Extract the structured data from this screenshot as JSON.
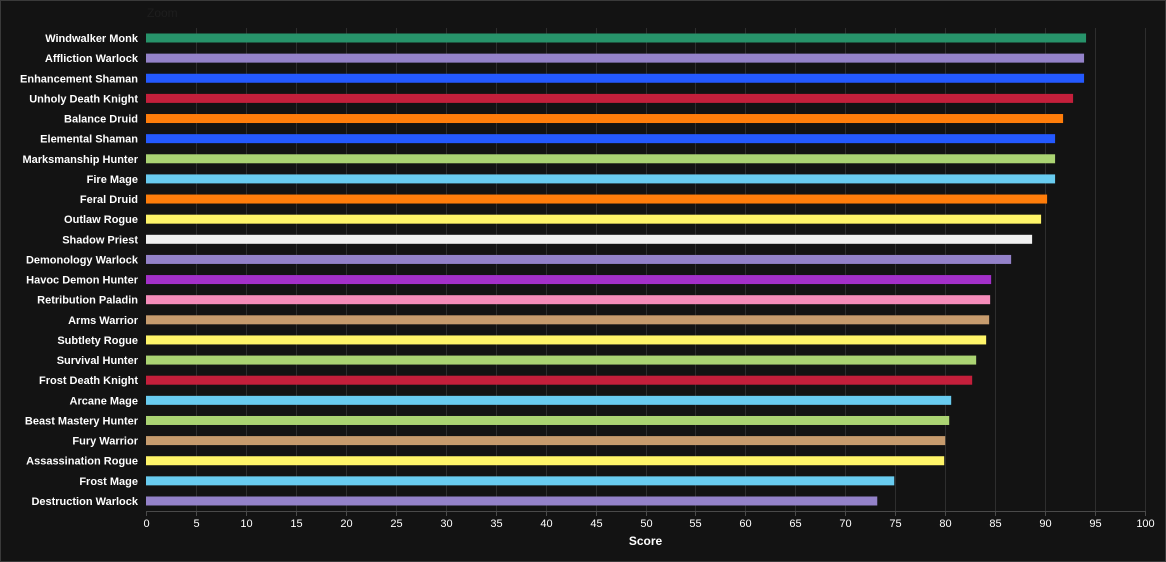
{
  "toolbar": {
    "zoom_label": "Zoom"
  },
  "chart_data": {
    "type": "bar",
    "orientation": "horizontal",
    "categories": [
      "Windwalker Monk",
      "Affliction Warlock",
      "Enhancement Shaman",
      "Unholy Death Knight",
      "Balance Druid",
      "Elemental Shaman",
      "Marksmanship Hunter",
      "Fire Mage",
      "Feral Druid",
      "Outlaw Rogue",
      "Shadow Priest",
      "Demonology Warlock",
      "Havoc Demon Hunter",
      "Retribution Paladin",
      "Arms Warrior",
      "Subtlety Rogue",
      "Survival Hunter",
      "Frost Death Knight",
      "Arcane Mage",
      "Beast Mastery Hunter",
      "Fury Warrior",
      "Assassination Rogue",
      "Frost Mage",
      "Destruction Warlock"
    ],
    "values": [
      94.1,
      93.9,
      93.9,
      92.8,
      91.8,
      91.0,
      91.0,
      91.0,
      90.2,
      89.6,
      88.7,
      86.6,
      84.6,
      84.5,
      84.4,
      84.1,
      83.1,
      82.7,
      80.6,
      80.4,
      80.0,
      79.9,
      74.9,
      73.2
    ],
    "colors": [
      "#27936a",
      "#9482c9",
      "#2459ff",
      "#c41f3b",
      "#ff7d0a",
      "#2459ff",
      "#abd473",
      "#69ccf0",
      "#ff7d0a",
      "#fff569",
      "#f0f0f0",
      "#9482c9",
      "#a330c9",
      "#f58cba",
      "#c79c6e",
      "#fff569",
      "#abd473",
      "#c41f3b",
      "#69ccf0",
      "#abd473",
      "#c79c6e",
      "#fff569",
      "#69ccf0",
      "#9482c9"
    ],
    "xlabel": "Score",
    "xlim": [
      0,
      100
    ],
    "xticks": [
      0,
      5,
      10,
      15,
      20,
      25,
      30,
      35,
      40,
      45,
      50,
      55,
      60,
      65,
      70,
      75,
      80,
      85,
      90,
      95,
      100
    ],
    "grid": "vertical",
    "background": "#131313",
    "grid_color": "#2e2e2e"
  }
}
